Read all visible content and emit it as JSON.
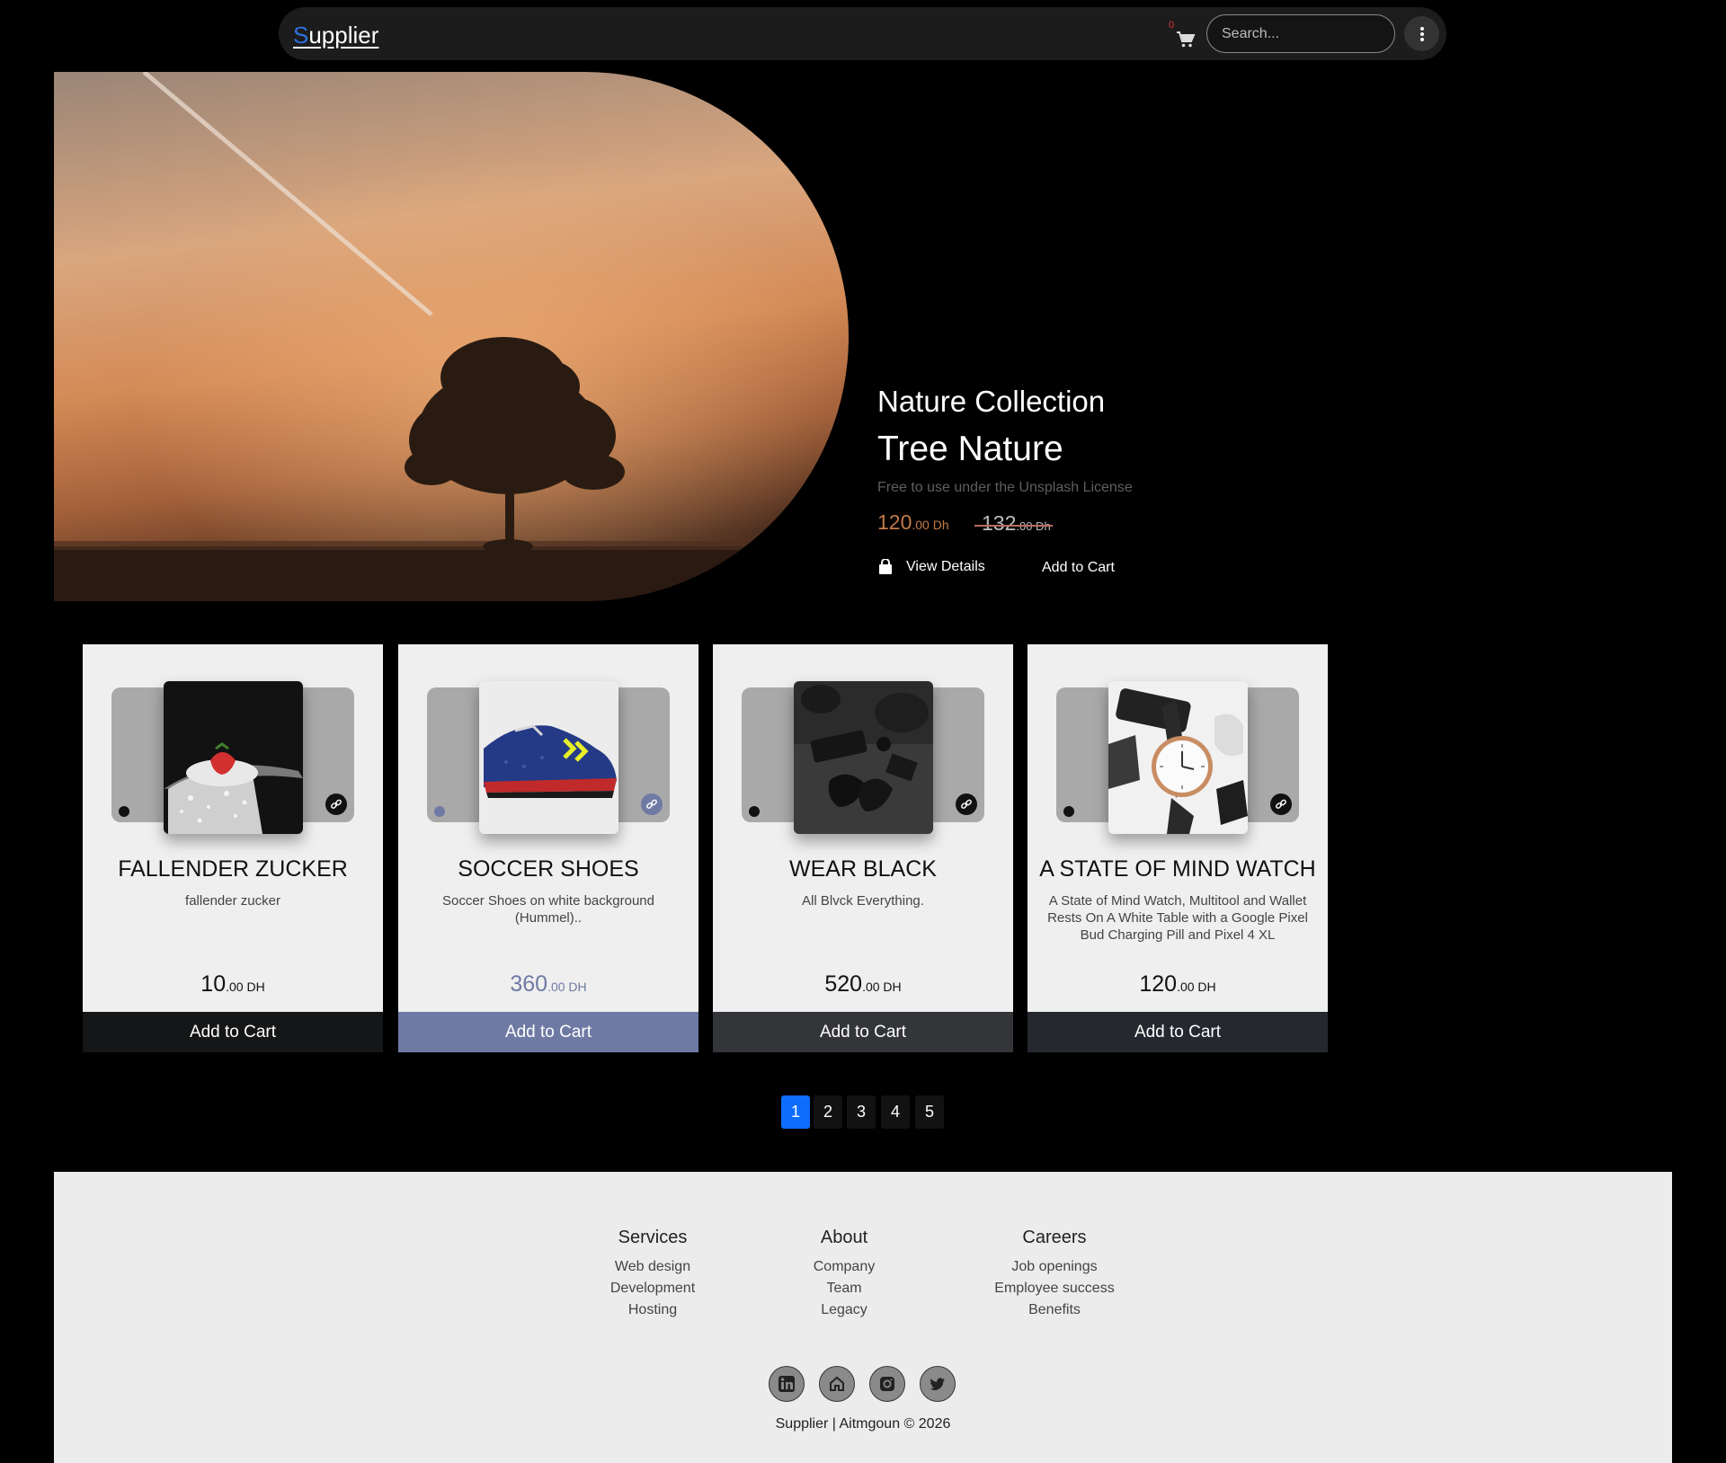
{
  "navbar": {
    "brand_first": "S",
    "brand_rest": "upplier",
    "cart_count": "0",
    "search_placeholder": "Search..."
  },
  "hero": {
    "collection": "Nature Collection",
    "title": "Tree Nature",
    "license": "Free to use under the Unsplash License",
    "price_int": "120",
    "price_dec": ".00 Dh",
    "old_price_int": "132",
    "old_price_dec": ".00 Dh",
    "view_details": "View Details",
    "add_to_cart": "Add to Cart"
  },
  "products": [
    {
      "name": "FALLENDER ZUCKER",
      "desc": "fallender zucker",
      "price_int": "10",
      "price_dec": ".00 DH",
      "button": "Add to Cart",
      "accent": "#151617",
      "price_color": "#111111"
    },
    {
      "name": "SOCCER SHOES",
      "desc": "Soccer Shoes on white background (Hummel)..",
      "price_int": "360",
      "price_dec": ".00 DH",
      "button": "Add to Cart",
      "accent": "#6f7aa4",
      "price_color": "#6f7aa4"
    },
    {
      "name": "WEAR BLACK",
      "desc": "All Blvck Everything.",
      "price_int": "520",
      "price_dec": ".00 DH",
      "button": "Add to Cart",
      "accent": "#333539",
      "price_color": "#111111"
    },
    {
      "name": "A STATE OF MIND WATCH",
      "desc": "A State of Mind Watch, Multitool and Wallet Rests On A White Table with a Google Pixel Bud Charging Pill and Pixel 4 XL",
      "price_int": "120",
      "price_dec": ".00 DH",
      "button": "Add to Cart",
      "accent": "#25282e",
      "price_color": "#111111"
    }
  ],
  "pagination": [
    "1",
    "2",
    "3",
    "4",
    "5"
  ],
  "footer": {
    "services": {
      "title": "Services",
      "items": [
        "Web design",
        "Development",
        "Hosting"
      ]
    },
    "about": {
      "title": "About",
      "items": [
        "Company",
        "Team",
        "Legacy"
      ]
    },
    "careers": {
      "title": "Careers",
      "items": [
        "Job openings",
        "Employee success",
        "Benefits"
      ]
    },
    "socials": [
      "linkedin-icon",
      "home-icon",
      "instagram-icon",
      "twitter-icon"
    ],
    "copyright": "Supplier | Aitmgoun © 2026"
  }
}
